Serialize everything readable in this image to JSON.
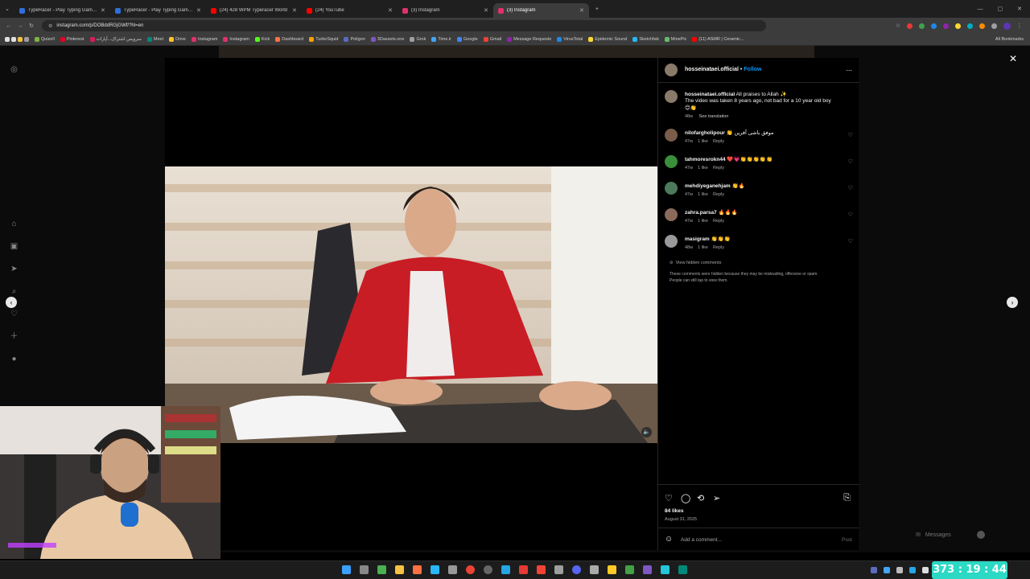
{
  "browser": {
    "tabs": [
      {
        "label": "TypeRacer - Play Typing Games",
        "color": "#2f6fdb"
      },
      {
        "label": "TypeRacer - Play Typing Games",
        "color": "#2f6fdb"
      },
      {
        "label": "(24) 428 WPM Typeracer World",
        "color": "#ff0000"
      },
      {
        "label": "(24) YouTube",
        "color": "#ff0000"
      },
      {
        "label": "(3) Instagram",
        "color": "#e1306c"
      },
      {
        "label": "(3) Instagram",
        "color": "#e1306c"
      }
    ],
    "url": "instagram.com/p/DOBddRGjGWf/?hl=en",
    "bookmarks": [
      {
        "label": "Quizell",
        "color": "#7cb342"
      },
      {
        "label": "Pinterest",
        "color": "#e60023"
      },
      {
        "label": "سرویس اشتراک...آپارات",
        "color": "#d81b60"
      },
      {
        "label": "Meet",
        "color": "#00897b"
      },
      {
        "label": "Drive",
        "color": "#fbc02d"
      },
      {
        "label": "Instagram",
        "color": "#e1306c"
      },
      {
        "label": "Instagram",
        "color": "#e1306c"
      },
      {
        "label": "Kick",
        "color": "#53fc18"
      },
      {
        "label": "Dashboard",
        "color": "#ff7043"
      },
      {
        "label": "TurboSquid",
        "color": "#ffa000"
      },
      {
        "label": "Poligon",
        "color": "#5c6bc0"
      },
      {
        "label": "3Dassets.one",
        "color": "#7e57c2"
      },
      {
        "label": "Grok",
        "color": "#9e9e9e"
      },
      {
        "label": "Time.ir",
        "color": "#42a5f5"
      },
      {
        "label": "Google",
        "color": "#4285f4"
      },
      {
        "label": "Gmail",
        "color": "#ea4335"
      },
      {
        "label": "Message Requests",
        "color": "#8e24aa"
      },
      {
        "label": "VirusTotal",
        "color": "#1e88e5"
      },
      {
        "label": "Epidemic Sound",
        "color": "#fdd835"
      },
      {
        "label": "Sketchfab",
        "color": "#29b6f6"
      },
      {
        "label": "MinePic",
        "color": "#66bb6a"
      },
      {
        "label": "(11) ASMR | Ceramic...",
        "color": "#ff0000"
      }
    ],
    "all_bookmarks_label": "All Bookmarks"
  },
  "post": {
    "author": "hosseinataei.official",
    "follow_label": "Follow",
    "more_label": "...",
    "caption_line1": "All praises to Allah ✨",
    "caption_line2": "The video was taken 8 years ago, not bad for a 10 year old boy",
    "caption_line3": "😊👏",
    "caption_age": "48w",
    "see_translation": "See translation",
    "comments": [
      {
        "user": "nilofargholipour",
        "text": "👏 موفق باشی آفرین",
        "age": "47w",
        "likes": "1 like",
        "reply": "Reply",
        "avatar_color": "#7a5c4a"
      },
      {
        "user": "tahmoresrokn44",
        "text": "❤️💗👏👏👏👏👏",
        "age": "47w",
        "likes": "1 like",
        "reply": "Reply",
        "avatar_color": "#3a8f3a"
      },
      {
        "user": "mehdiyeganehjam",
        "text": "👏🔥",
        "age": "47w",
        "likes": "1 like",
        "reply": "Reply",
        "avatar_color": "#4c7a5a"
      },
      {
        "user": "zahra.parsa7",
        "text": "🔥🔥🔥",
        "age": "47w",
        "likes": "1 like",
        "reply": "Reply",
        "avatar_color": "#8a6a5a"
      },
      {
        "user": "masigram",
        "text": "👏👏👏",
        "age": "48w",
        "likes": "1 like",
        "reply": "Reply",
        "avatar_color": "#999999"
      }
    ],
    "view_hidden": "View hidden comments",
    "hidden_note_line1": "These comments were hidden because they may be misleading, offensive or spam.",
    "hidden_note_line2": "People can still tap to view them.",
    "likes": "84 likes",
    "date": "August 31, 2025",
    "add_comment_placeholder": "Add a comment...",
    "post_label": "Post"
  },
  "overlay": {
    "messages_label": "Messages",
    "timer": "373 : 19 : 44"
  },
  "icons": {
    "close": "close-icon",
    "prev": "chevron-left-icon",
    "next": "chevron-right-icon",
    "like": "heart-icon",
    "comment": "comment-icon",
    "share": "share-icon",
    "save": "bookmark-icon"
  },
  "colors": {
    "accent_follow": "#0095f6",
    "timer_bg": "#2bd9c4",
    "panel_bg": "#000000"
  }
}
